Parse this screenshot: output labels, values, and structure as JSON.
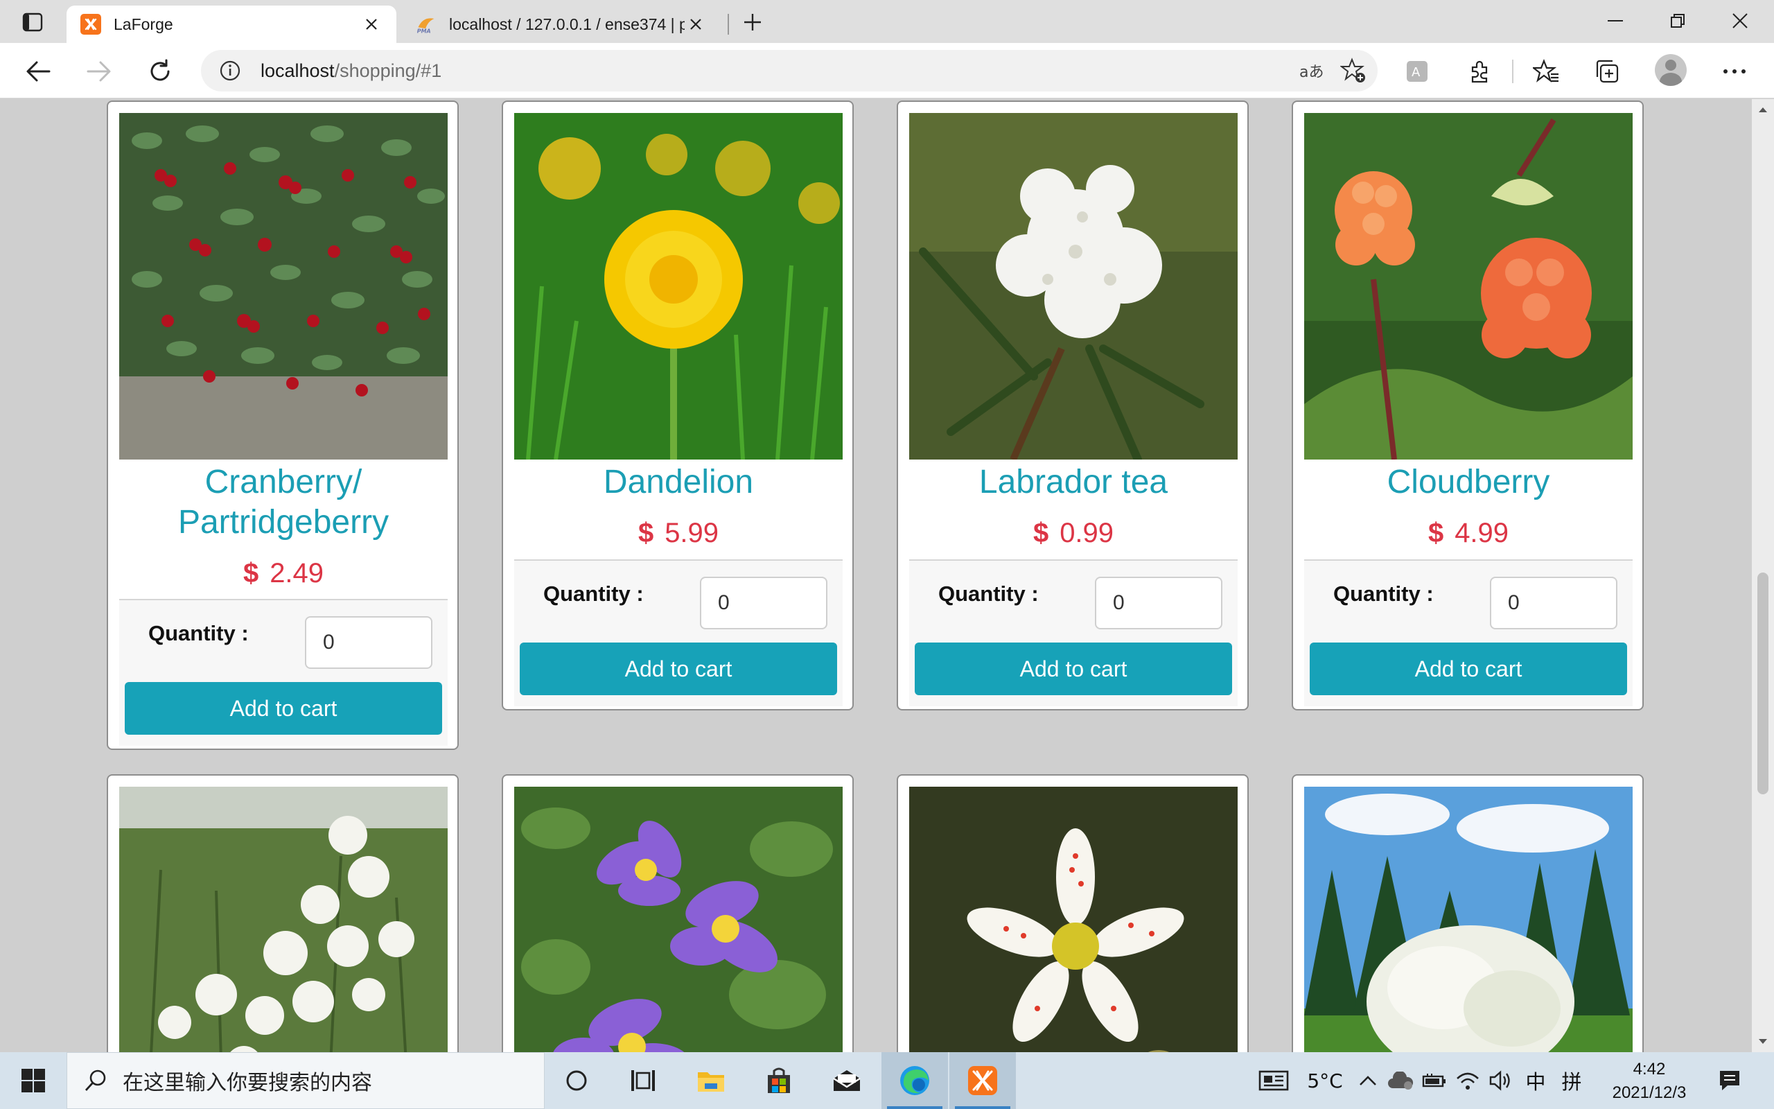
{
  "browser": {
    "tabs": [
      {
        "title": "LaForge",
        "active": true
      },
      {
        "title": "localhost / 127.0.0.1 / ense374 | p",
        "active": false
      }
    ],
    "address": {
      "host": "localhost",
      "path": "/shopping/#1"
    }
  },
  "shop": {
    "quantity_label": "Quantity :",
    "add_to_cart_label": "Add to cart",
    "currency_symbol": "$",
    "products": [
      {
        "name": "Cranberry/ Partridgeberry",
        "price": "2.49",
        "quantity": "0",
        "image": "cranberry-photo"
      },
      {
        "name": "Dandelion",
        "price": "5.99",
        "quantity": "0",
        "image": "dandelion-photo"
      },
      {
        "name": "Labrador tea",
        "price": "0.99",
        "quantity": "0",
        "image": "labrador-tea-photo"
      },
      {
        "name": "Cloudberry",
        "price": "4.99",
        "quantity": "0",
        "image": "cloudberry-photo"
      },
      {
        "image": "white-flower-shrub-photo"
      },
      {
        "image": "purple-crocus-photo"
      },
      {
        "image": "spotted-saxifrage-photo"
      },
      {
        "image": "flowering-tree-park-photo"
      }
    ]
  },
  "taskbar": {
    "search_placeholder": "在这里输入你要搜索的内容",
    "weather": "5°C",
    "ime_lang": "中",
    "ime_mode": "拼",
    "time": "4:42",
    "date": "2021/12/3"
  },
  "colors": {
    "accent": "#17a2b8",
    "title": "#1b9eb4",
    "price": "#dc3545"
  }
}
